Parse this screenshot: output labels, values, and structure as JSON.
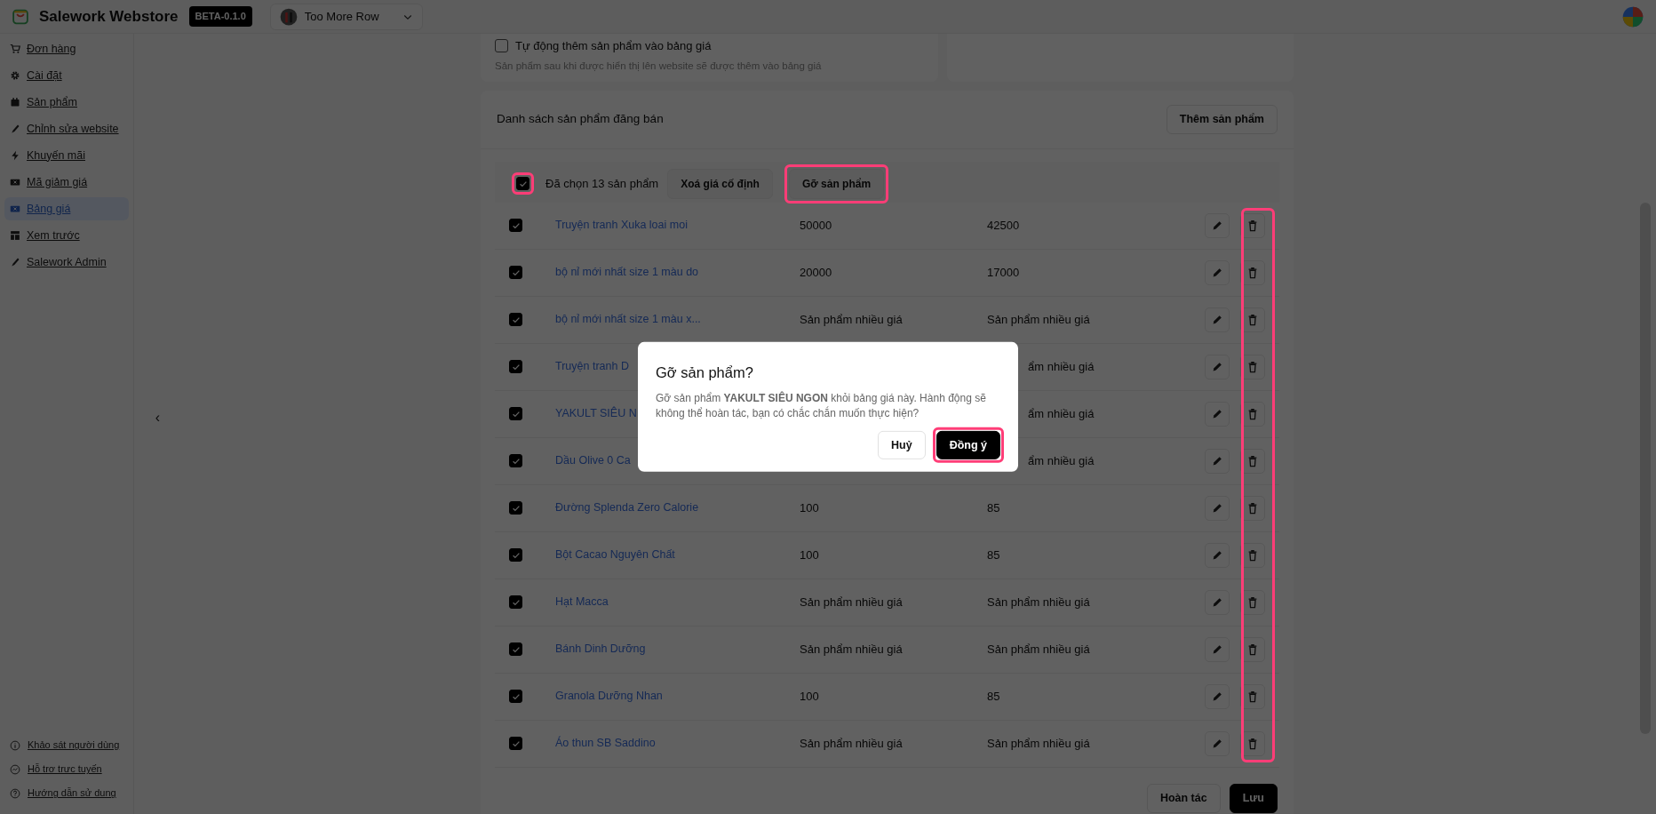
{
  "header": {
    "app_name": "Salework Webstore",
    "version_badge": "BETA-0.1.0",
    "store_name": "Too More Row"
  },
  "sidebar": {
    "items": [
      {
        "label": "Đơn hàng",
        "selected": false
      },
      {
        "label": "Cài đặt",
        "selected": false
      },
      {
        "label": "Sản phẩm",
        "selected": false
      },
      {
        "label": "Chỉnh sửa website",
        "selected": false
      },
      {
        "label": "Khuyến mãi",
        "selected": false
      },
      {
        "label": "Mã giảm giá",
        "selected": false
      },
      {
        "label": "Bảng giá",
        "selected": true
      },
      {
        "label": "Xem trước",
        "selected": false
      },
      {
        "label": "Salework Admin",
        "selected": false
      }
    ],
    "collapse_toggle": "‹",
    "footer_links": [
      "Khảo sát người dùng",
      "Hỗ trợ trực tuyến",
      "Hướng dẫn sử dụng"
    ]
  },
  "settings_card": {
    "auto_add": {
      "label": "Tự động thêm sản phẩm vào bảng giá",
      "checked": false,
      "hint": "Sản phẩm sau khi được hiển thị lên website sẽ được thêm vào bảng giá"
    }
  },
  "product_list": {
    "title": "Danh sách sản phẩm đăng bán",
    "add_button": "Thêm sản phẩm",
    "select_all": {
      "checked": true,
      "highlighted": true
    },
    "selected_count": "Đã chọn 13 sản phẩm",
    "actions": [
      {
        "label": "Xoá giá cố định",
        "highlighted": false
      },
      {
        "label": "Gỡ sản phẩm",
        "highlighted": true
      }
    ],
    "delete_column_highlighted": true,
    "rows": [
      {
        "name": "Truyện tranh Xuka loai moi",
        "price": "50000",
        "sale_price": "42500",
        "checked": true
      },
      {
        "name": "bộ nỉ mới nhất size 1 màu do",
        "price": "20000",
        "sale_price": "17000",
        "checked": true
      },
      {
        "name": "bộ nỉ mới nhất size 1 màu x...",
        "price": "Sản phẩm nhiều giá",
        "sale_price": "Sản phẩm nhiều giá",
        "checked": true
      },
      {
        "name": "Truyện tranh D",
        "sale_price": "ẩm nhiều giá",
        "sale_price_cut": true,
        "checked": true
      },
      {
        "name": "YAKULT SIÊU N",
        "sale_price": "ẩm nhiều giá",
        "sale_price_cut": true,
        "checked": true
      },
      {
        "name": "Dầu Olive 0 Ca",
        "sale_price": "ẩm nhiều giá",
        "sale_price_cut": true,
        "checked": true
      },
      {
        "name": "Đường Splenda Zero Calorie",
        "price": "100",
        "sale_price": "85",
        "checked": true
      },
      {
        "name": "Bột Cacao Nguyên Chất",
        "price": "100",
        "sale_price": "85",
        "checked": true
      },
      {
        "name": "Hạt Macca",
        "price": "Sản phẩm nhiều giá",
        "sale_price": "Sản phẩm nhiều giá",
        "checked": true
      },
      {
        "name": "Bánh Dinh Dưỡng",
        "price": "Sản phẩm nhiều giá",
        "sale_price": "Sản phẩm nhiều giá",
        "checked": true
      },
      {
        "name": "Granola Dưỡng Nhan",
        "price": "100",
        "sale_price": "85",
        "checked": true
      },
      {
        "name": "Áo thun SB Saddino",
        "price": "Sản phẩm nhiều giá",
        "sale_price": "Sản phẩm nhiều giá",
        "checked": true
      }
    ]
  },
  "footer_buttons": [
    {
      "label": "Hoàn tác",
      "kind": "secondary"
    },
    {
      "label": "Lưu",
      "kind": "primary"
    }
  ],
  "dialog": {
    "title": "Gỡ sản phẩm?",
    "message": "Gỡ sản phẩm **YAKULT SIÊU NGON** khỏi bảng giá này. Hành động sẽ không thể hoàn tác, bạn có chắc chắn muốn thực hiện?",
    "buttons": [
      {
        "label": "Huỷ",
        "kind": "secondary",
        "highlighted": false
      },
      {
        "label": "Đồng ý",
        "kind": "primary",
        "highlighted": true
      }
    ]
  }
}
